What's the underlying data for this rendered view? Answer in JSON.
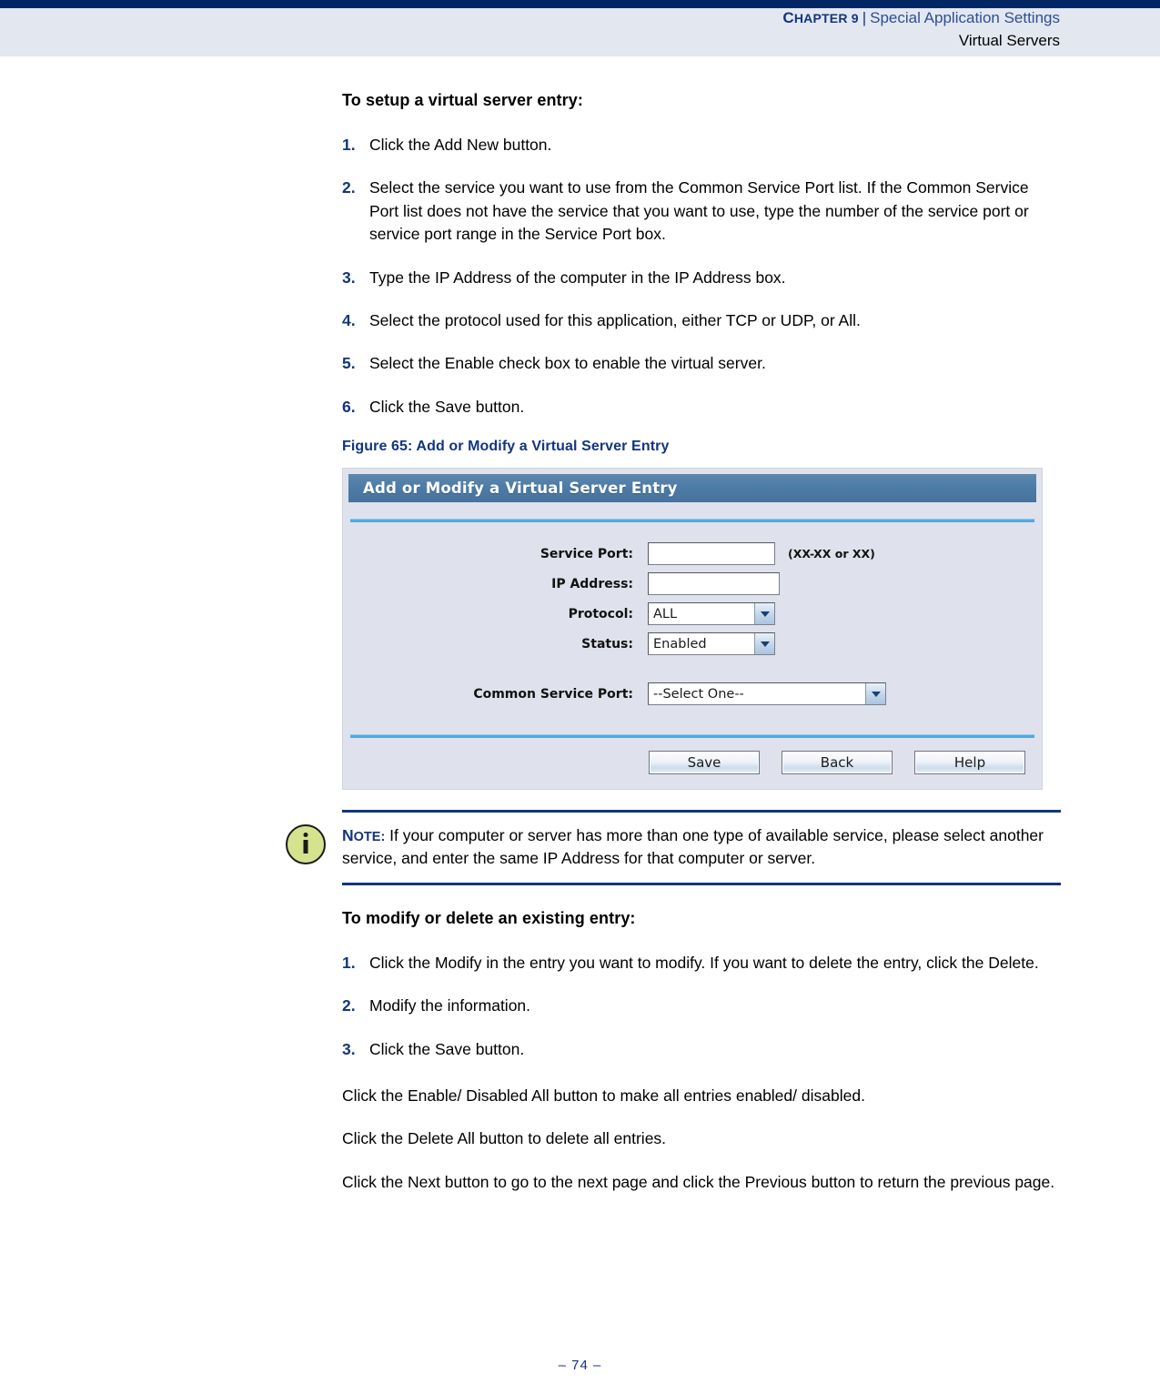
{
  "header": {
    "chapter_label": "CHAPTER 9",
    "chapter_caps": "C",
    "chapter_rest": "HAPTER 9",
    "divider": "|",
    "section": "Special Application Settings",
    "subsection": "Virtual Servers"
  },
  "setup": {
    "heading": "To setup a virtual server entry:",
    "steps": [
      {
        "num": "1.",
        "text": "Click the Add New button."
      },
      {
        "num": "2.",
        "text": "Select the service you want to use from the Common Service Port list. If the Common Service Port list does not have the service that you want to use, type the number of the service port or service port range in the Service Port box."
      },
      {
        "num": "3.",
        "text": "Type the IP Address of the computer in the IP Address box."
      },
      {
        "num": "4.",
        "text": "Select the protocol used for this application, either TCP or UDP, or All."
      },
      {
        "num": "5.",
        "text": "Select the Enable check box to enable the virtual server."
      },
      {
        "num": "6.",
        "text": "Click the Save button."
      }
    ]
  },
  "figure": {
    "caption": "Figure 65:  Add or Modify a Virtual Server Entry",
    "panel_title": "Add or Modify a Virtual Server Entry",
    "fields": {
      "service_port_label": "Service Port:",
      "service_port_value": "",
      "service_port_hint": "(XX-XX or XX)",
      "ip_address_label": "IP Address:",
      "ip_address_value": "",
      "protocol_label": "Protocol:",
      "protocol_value": "ALL",
      "status_label": "Status:",
      "status_value": "Enabled",
      "common_service_port_label": "Common Service Port:",
      "common_service_port_value": "--Select One--"
    },
    "buttons": {
      "save": "Save",
      "back": "Back",
      "help": "Help"
    },
    "colors": {
      "titlebar": "#4e7ca6",
      "panel_bg": "#dfe2ec",
      "rule": "#56a7de"
    }
  },
  "note": {
    "label_caps": "N",
    "label_rest": "OTE:",
    "text": " If your computer or server has more than one type of available service, please select another service, and enter the same IP Address for that computer or server."
  },
  "modify": {
    "heading": "To modify or delete an existing entry:",
    "steps": [
      {
        "num": "1.",
        "text": "Click the Modify in the entry you want to modify. If you want to delete the entry, click the Delete."
      },
      {
        "num": "2.",
        "text": "Modify the information."
      },
      {
        "num": "3.",
        "text": "Click the Save button."
      }
    ],
    "paragraphs": [
      "Click the Enable/ Disabled All button to make all entries enabled/ disabled.",
      "Click the Delete All button to delete all entries.",
      "Click the Next button to go to the next page and click the Previous button to return the previous page."
    ]
  },
  "footer": {
    "page_number": "–  74  –"
  }
}
